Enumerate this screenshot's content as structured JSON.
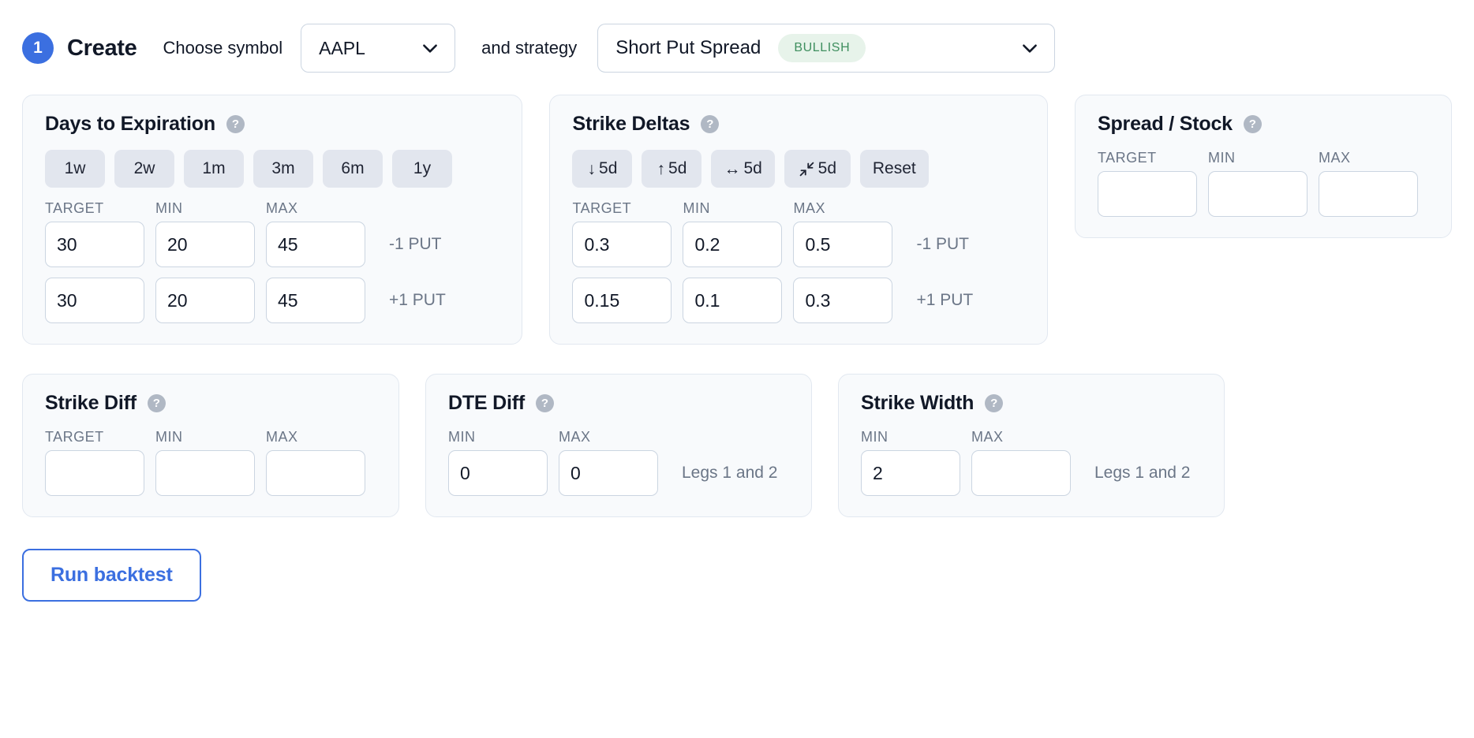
{
  "header": {
    "step_number": "1",
    "title": "Create",
    "symbol_label": "Choose symbol",
    "symbol_value": "AAPL",
    "strategy_label": "and strategy",
    "strategy_value": "Short Put Spread",
    "strategy_badge": "BULLISH",
    "accent_color": "#3b6fe0",
    "badge_bg": "#e7f3ea",
    "badge_text_color": "#3f8f5f"
  },
  "columns": {
    "target": "TARGET",
    "min": "MIN",
    "max": "MAX"
  },
  "cards": {
    "dte": {
      "title": "Days to Expiration",
      "help": "?",
      "presets": [
        "1w",
        "2w",
        "1m",
        "3m",
        "6m",
        "1y"
      ],
      "rows": [
        {
          "target": "30",
          "min": "20",
          "max": "45",
          "leg": "-1 PUT"
        },
        {
          "target": "30",
          "min": "20",
          "max": "45",
          "leg": "+1 PUT"
        }
      ]
    },
    "deltas": {
      "title": "Strike Deltas",
      "help": "?",
      "presets": [
        {
          "icon": "arrow-down-icon",
          "glyph": "↓",
          "label": "5d"
        },
        {
          "icon": "arrow-up-icon",
          "glyph": "↑",
          "label": "5d"
        },
        {
          "icon": "arrow-left-right-icon",
          "glyph": "↔",
          "label": "5d"
        },
        {
          "icon": "arrows-converge-icon",
          "glyph": "",
          "label": "5d"
        },
        {
          "icon": "reset-icon",
          "glyph": "",
          "label": "Reset"
        }
      ],
      "rows": [
        {
          "target": "0.3",
          "min": "0.2",
          "max": "0.5",
          "leg": "-1 PUT"
        },
        {
          "target": "0.15",
          "min": "0.1",
          "max": "0.3",
          "leg": "+1 PUT"
        }
      ]
    },
    "spread_stock": {
      "title": "Spread / Stock",
      "help": "?",
      "values": {
        "target": "",
        "min": "",
        "max": ""
      }
    },
    "strike_diff": {
      "title": "Strike Diff",
      "help": "?",
      "values": {
        "target": "",
        "min": "",
        "max": ""
      }
    },
    "dte_diff": {
      "title": "DTE Diff",
      "help": "?",
      "values": {
        "min": "0",
        "max": "0"
      },
      "leg": "Legs 1 and 2"
    },
    "strike_width": {
      "title": "Strike Width",
      "help": "?",
      "values": {
        "min": "2",
        "max": ""
      },
      "leg": "Legs 1 and 2"
    }
  },
  "footer": {
    "run_label": "Run backtest"
  }
}
